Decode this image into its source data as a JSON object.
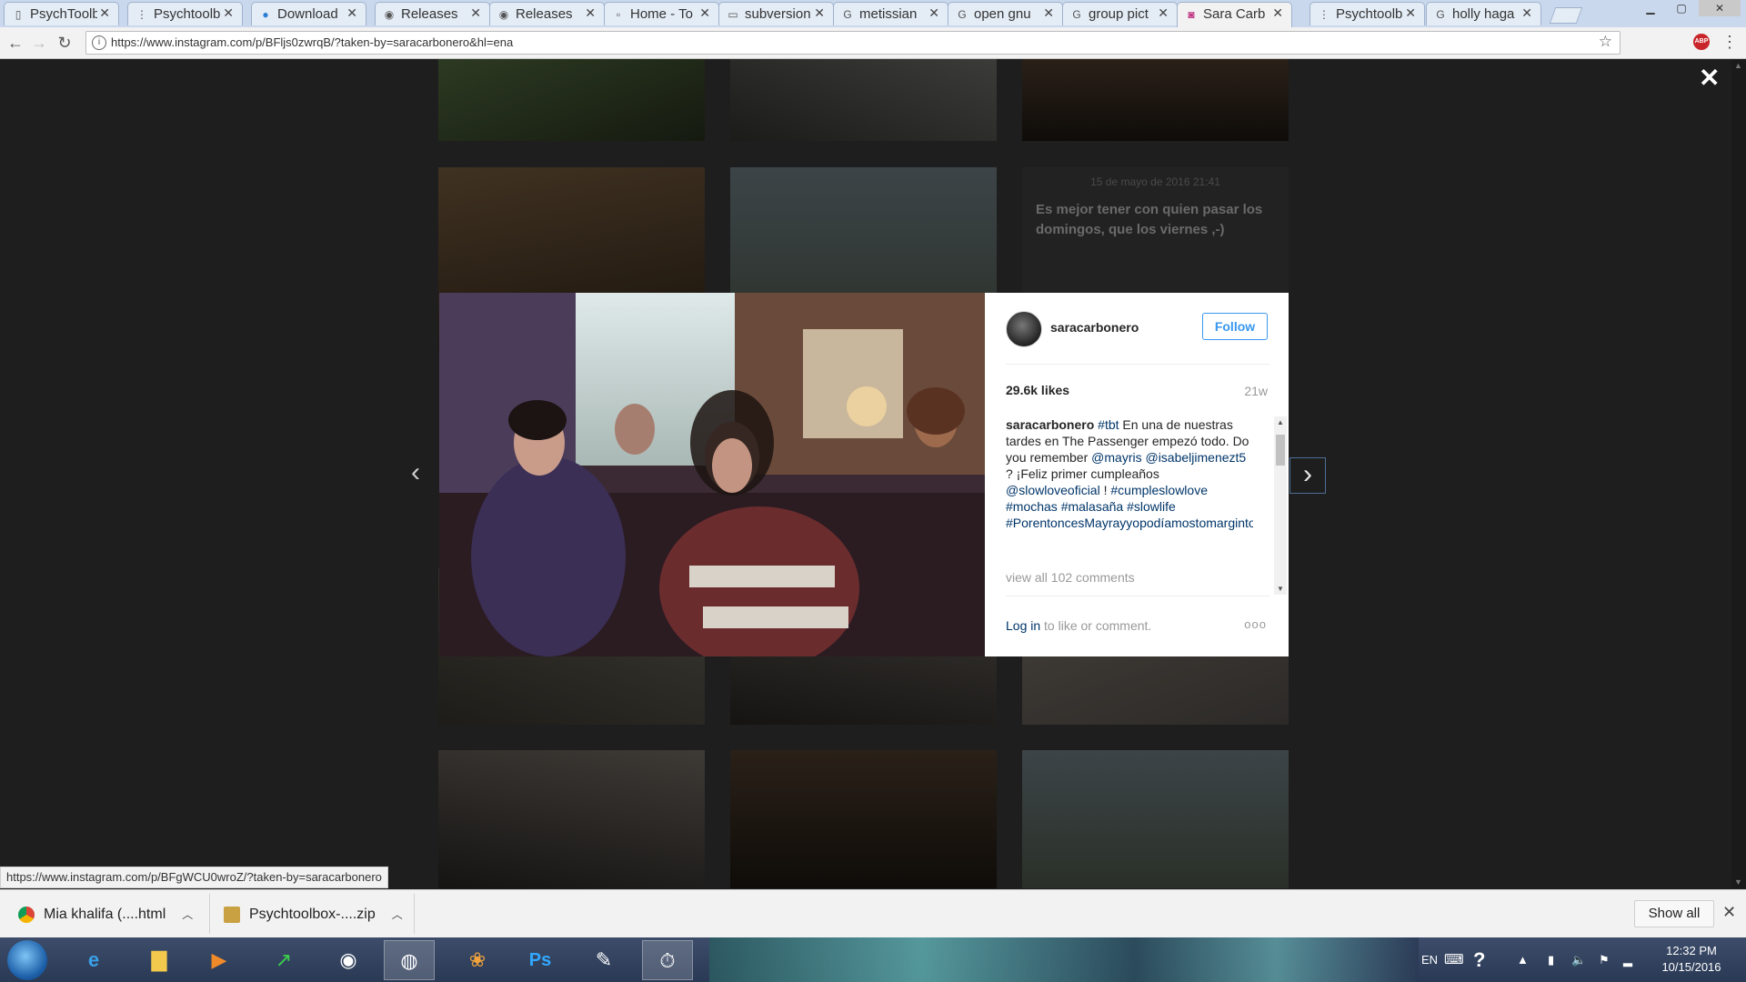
{
  "browser": {
    "tabs": [
      {
        "title": "PsychToolbox",
        "icon": "page-icon"
      },
      {
        "title": "Psychtoolbox",
        "icon": "psychtoolbox-icon"
      },
      {
        "title": "Download",
        "icon": "dot-icon"
      },
      {
        "title": "Releases",
        "icon": "github-icon"
      },
      {
        "title": "Releases",
        "icon": "github-icon"
      },
      {
        "title": "Home - To",
        "icon": "page-icon"
      },
      {
        "title": "subversion",
        "icon": "page-icon"
      },
      {
        "title": "metissian",
        "icon": "google-icon"
      },
      {
        "title": "open gnu",
        "icon": "google-icon"
      },
      {
        "title": "group pict",
        "icon": "google-icon"
      },
      {
        "title": "Sara Carb",
        "icon": "instagram-icon"
      },
      {
        "title": "Psychtoolb",
        "icon": "psychtoolbox-icon"
      },
      {
        "title": "holly haga",
        "icon": "google-icon"
      }
    ],
    "active_tab_index": 10,
    "url": "https://www.instagram.com/p/BFljs0zwrqB/?taken-by=saracarbonero&hl=ena",
    "status_url": "https://www.instagram.com/p/BFgWCU0wroZ/?taken-by=saracarbonero"
  },
  "background_post": {
    "date": "15 de mayo de 2016 21:41",
    "caption": "Es mejor tener con quien pasar los domingos, que los viernes ,-)"
  },
  "modal": {
    "username": "saracarbonero",
    "follow_label": "Follow",
    "likes": "29.6k likes",
    "age": "21w",
    "comment": {
      "user": "saracarbonero",
      "tag1": "#tbt",
      "text1": "En una de nuestras tardes en The Passenger empezó todo. Do you remember",
      "mention1": "@mayris",
      "mention2": "@isabeljimenezt5",
      "text2": "? ¡Feliz primer cumpleaños",
      "mention3": "@slowloveoficial",
      "text3": "!",
      "tags": "#cumpleslowlove #mochas #malasaña #slowlife #PorentoncesMayrayyopodíamostomargintonics"
    },
    "view_all": "view all 102 comments",
    "login_link": "Log in",
    "login_text": "to like or comment.",
    "more": "ooo"
  },
  "downloads": {
    "items": [
      {
        "name": "Mia khalifa (....html"
      },
      {
        "name": "Psychtoolbox-....zip"
      }
    ],
    "show_all": "Show all"
  },
  "taskbar": {
    "language": "EN",
    "time": "12:32 PM",
    "date": "10/15/2016"
  },
  "colors": {
    "ig_blue": "#3897f0",
    "ig_link": "#003569",
    "overlay": "#1e1e1e"
  }
}
